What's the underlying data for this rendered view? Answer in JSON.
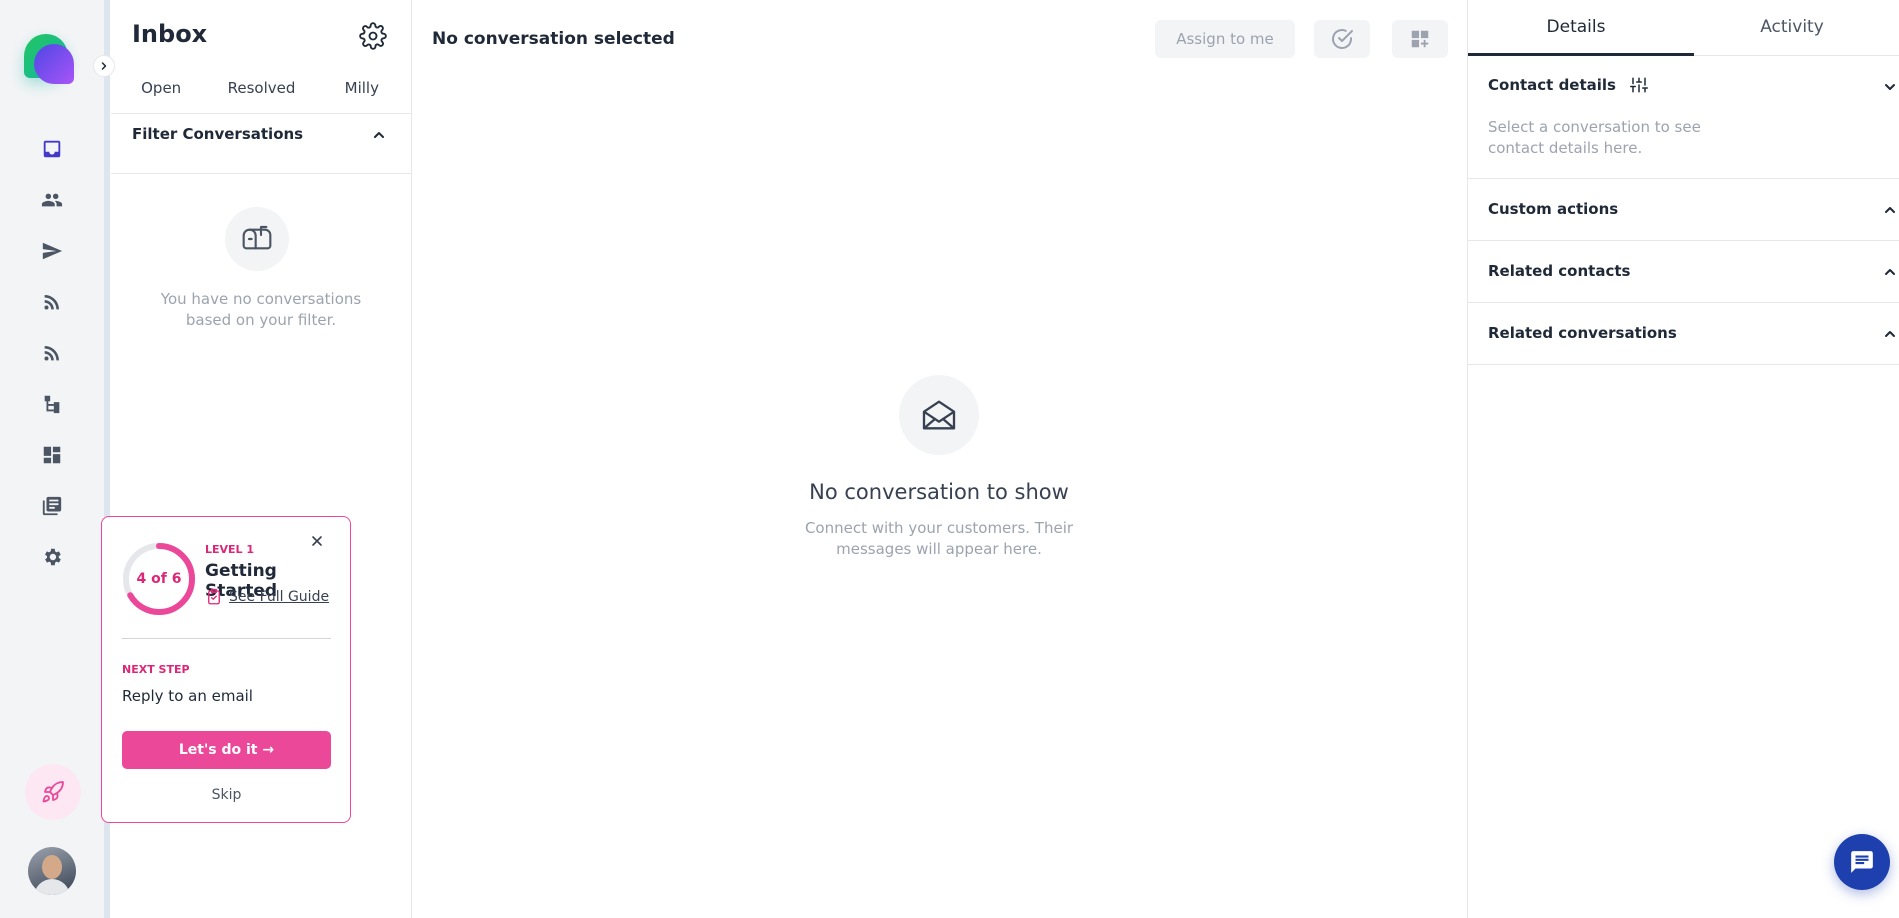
{
  "inbox": {
    "title": "Inbox",
    "tabs": [
      "Open",
      "Resolved",
      "Milly"
    ],
    "filter_label": "Filter Conversations",
    "empty_text": "You have no conversations based on your filter."
  },
  "guide": {
    "progress_text": "4 of 6",
    "progress_fraction": 0.667,
    "level": "LEVEL 1",
    "title": "Getting Started",
    "link_label": "See Full Guide",
    "next_step_label": "NEXT STEP",
    "next_action": "Reply to an email",
    "cta_label": "Let's do it →",
    "skip_label": "Skip"
  },
  "main": {
    "title": "No conversation selected",
    "assign_label": "Assign to me",
    "empty_title": "No conversation to show",
    "empty_sub": "Connect with your customers. Their messages will appear here."
  },
  "right": {
    "tabs": [
      "Details",
      "Activity"
    ],
    "active_tab": "Details",
    "sections": [
      {
        "title": "Contact details",
        "text": "Select a conversation to see contact details here."
      },
      {
        "title": "Custom actions"
      },
      {
        "title": "Related contacts"
      },
      {
        "title": "Related conversations"
      }
    ]
  },
  "colors": {
    "accent_pink": "#ec4899",
    "rail_active": "#4338ca",
    "chat_fab": "#1e40af"
  },
  "icons": {
    "rail": [
      "inbox-icon",
      "contacts-icon",
      "send-icon",
      "rss-icon",
      "rss-icon",
      "workflow-icon",
      "dashboard-icon",
      "library-icon",
      "gear-icon"
    ]
  }
}
